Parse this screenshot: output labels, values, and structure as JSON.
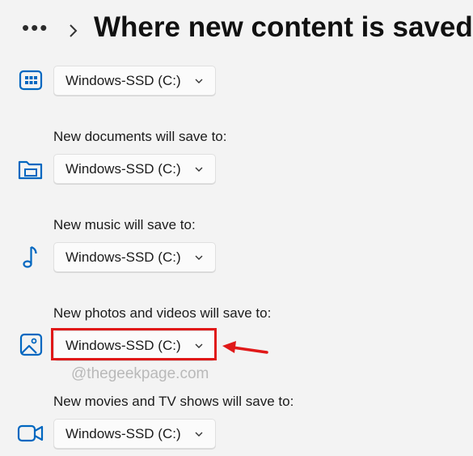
{
  "header": {
    "more": "•••",
    "title": "Where new content is saved"
  },
  "rows": [
    {
      "label": "",
      "icon": "apps-icon",
      "value": "Windows-SSD (C:)"
    },
    {
      "label": "New documents will save to:",
      "icon": "documents-folder-icon",
      "value": "Windows-SSD (C:)"
    },
    {
      "label": "New music will save to:",
      "icon": "music-note-icon",
      "value": "Windows-SSD (C:)"
    },
    {
      "label": "New photos and videos will save to:",
      "icon": "photo-icon",
      "value": "Windows-SSD (C:)"
    },
    {
      "label": "New movies and TV shows will save to:",
      "icon": "video-camera-icon",
      "value": "Windows-SSD (C:)"
    }
  ],
  "watermark": "@thegeekpage.com",
  "colors": {
    "accent": "#0067c0",
    "highlight": "#e01818",
    "background": "#f3f3f3"
  }
}
